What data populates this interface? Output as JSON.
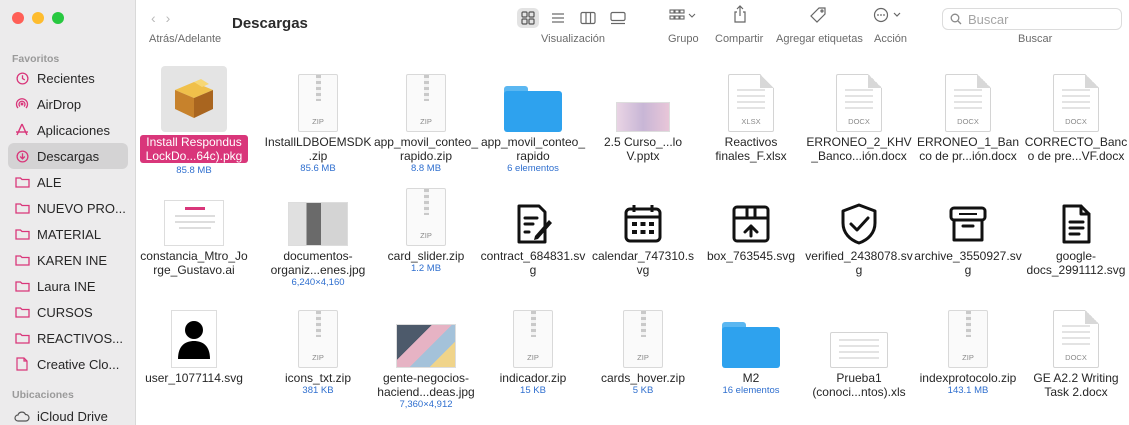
{
  "colors": {
    "close": "#ff5f57",
    "minimize": "#febc2e",
    "maximize": "#28c840",
    "selection": "#d9367a",
    "meta": "#2f6fcf",
    "sidebar_bg": "#ecebec"
  },
  "sidebar": {
    "favorites_title": "Favoritos",
    "favorites": [
      {
        "label": "Recientes",
        "icon": "clock-icon"
      },
      {
        "label": "AirDrop",
        "icon": "airdrop-icon"
      },
      {
        "label": "Aplicaciones",
        "icon": "applications-icon"
      },
      {
        "label": "Descargas",
        "icon": "downloads-icon"
      },
      {
        "label": "ALE",
        "icon": "folder-icon"
      },
      {
        "label": "NUEVO PRO...",
        "icon": "folder-icon"
      },
      {
        "label": "MATERIAL",
        "icon": "folder-icon"
      },
      {
        "label": "KAREN INE",
        "icon": "folder-icon"
      },
      {
        "label": "Laura INE",
        "icon": "folder-icon"
      },
      {
        "label": "CURSOS",
        "icon": "folder-icon"
      },
      {
        "label": "REACTIVOS...",
        "icon": "folder-icon"
      },
      {
        "label": "Creative Clo...",
        "icon": "document-icon"
      }
    ],
    "locations_title": "Ubicaciones",
    "locations": [
      {
        "label": "iCloud Drive",
        "icon": "cloud-icon"
      }
    ]
  },
  "toolbar": {
    "nav_label": "Atrás/Adelante",
    "title": "Descargas",
    "view_label": "Visualización",
    "group_label": "Grupo",
    "share_label": "Compartir",
    "tags_label": "Agregar etiquetas",
    "action_label": "Acción",
    "search_placeholder": "Buscar",
    "search_label": "Buscar"
  },
  "files": [
    {
      "name": "Install Respondus LockDo...64c).pkg",
      "meta": "85.8 MB",
      "kind": "package",
      "selected": true
    },
    {
      "name": "InstallLDBOEMSDK.zip",
      "meta": "85.6 MB",
      "kind": "zip"
    },
    {
      "name": "app_movil_conteo_rapido.zip",
      "meta": "8.8 MB",
      "kind": "zip"
    },
    {
      "name": "app_movil_conteo_rapido",
      "meta": "6 elementos",
      "kind": "folder"
    },
    {
      "name": "2.5 Curso_...lo V.pptx",
      "meta": "",
      "kind": "slides"
    },
    {
      "name": "Reactivos finales_F.xlsx",
      "meta": "",
      "kind": "xlsx",
      "badge": "XLSX"
    },
    {
      "name": "ERRONEO_2_KHV_Banco...ión.docx",
      "meta": "",
      "kind": "docx",
      "badge": "DOCX"
    },
    {
      "name": "ERRONEO_1_Banco de pr...ión.docx",
      "meta": "",
      "kind": "docx",
      "badge": "DOCX"
    },
    {
      "name": "CORRECTO_Banco de pre...VF.docx",
      "meta": "",
      "kind": "docx",
      "badge": "DOCX"
    },
    {
      "name": "constancia_Mtro_Jorge_Gustavo.ai",
      "meta": "",
      "kind": "ai"
    },
    {
      "name": "documentos-organiz...enes.jpg",
      "meta": "6,240×4,160",
      "kind": "photo1"
    },
    {
      "name": "card_slider.zip",
      "meta": "1.2 MB",
      "kind": "zip"
    },
    {
      "name": "contract_684831.svg",
      "meta": "",
      "kind": "contract"
    },
    {
      "name": "calendar_747310.svg",
      "meta": "",
      "kind": "calendar"
    },
    {
      "name": "box_763545.svg",
      "meta": "",
      "kind": "box"
    },
    {
      "name": "verified_2438078.svg",
      "meta": "",
      "kind": "verified"
    },
    {
      "name": "archive_3550927.svg",
      "meta": "",
      "kind": "archive"
    },
    {
      "name": "google-docs_2991112.svg",
      "meta": "",
      "kind": "gdocs"
    },
    {
      "name": "user_1077114.svg",
      "meta": "",
      "kind": "user"
    },
    {
      "name": "icons_txt.zip",
      "meta": "381 KB",
      "kind": "zip"
    },
    {
      "name": "gente-negocios-haciend...deas.jpg",
      "meta": "7,360×4,912",
      "kind": "photo2"
    },
    {
      "name": "indicador.zip",
      "meta": "15 KB",
      "kind": "zip"
    },
    {
      "name": "cards_hover.zip",
      "meta": "5 KB",
      "kind": "zip"
    },
    {
      "name": "M2",
      "meta": "16 elementos",
      "kind": "folder"
    },
    {
      "name": "Prueba1 (conoci...ntos).xls",
      "meta": "",
      "kind": "xls"
    },
    {
      "name": "indexprotocolo.zip",
      "meta": "143.1 MB",
      "kind": "zip"
    },
    {
      "name": "GE A2.2 Writing Task 2.docx",
      "meta": "",
      "kind": "docx",
      "badge": "DOCX"
    }
  ],
  "zip_badge": "ZIP"
}
